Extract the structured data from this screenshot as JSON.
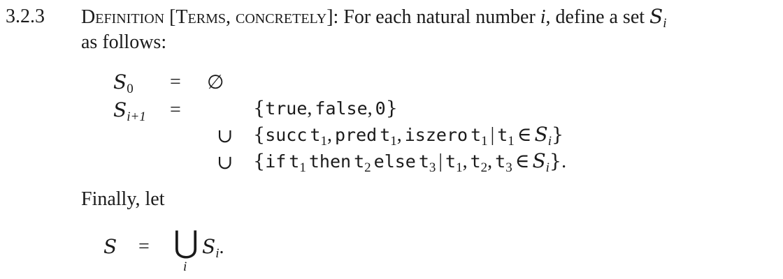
{
  "section_number": "3.2.3",
  "definition": {
    "head": "Definition",
    "bracket_label": "[Terms, concretely]:",
    "intro_text": "For each natural number",
    "var_i": "i",
    "define_text": ", define a set",
    "set_name": "S",
    "set_subscript": "i",
    "continuation": "as follows:"
  },
  "equations": {
    "s0": {
      "name": "S",
      "sub": "0",
      "eq": "=",
      "rhs": "∅"
    },
    "si1": {
      "name": "S",
      "sub": "i+1",
      "eq": "=",
      "line1": {
        "open": "{",
        "t_true": "true",
        "comma1": ",",
        "t_false": "false",
        "comma2": ",",
        "t_zero": "0",
        "close": "}"
      },
      "union": "∪",
      "line2": {
        "open": "{",
        "succ": "succ",
        "t": "t",
        "one": "1",
        "comma": ",",
        "pred": "pred",
        "iszero": "iszero",
        "bar": "|",
        "in": "∈",
        "S": "S",
        "i": "i",
        "close": "}"
      },
      "line3": {
        "open": "{",
        "if": "if",
        "t": "t",
        "one": "1",
        "then": "then",
        "two": "2",
        "else": "else",
        "three": "3",
        "bar": "|",
        "comma": ",",
        "in": "∈",
        "S": "S",
        "i": "i",
        "close": "}",
        "period": "."
      }
    }
  },
  "finally_text": "Finally, let",
  "final_eq": {
    "name": "S",
    "eq": "=",
    "bigcup": "⋃",
    "under": "i",
    "rhs_name": "S",
    "rhs_sub": "i",
    "period": "."
  }
}
